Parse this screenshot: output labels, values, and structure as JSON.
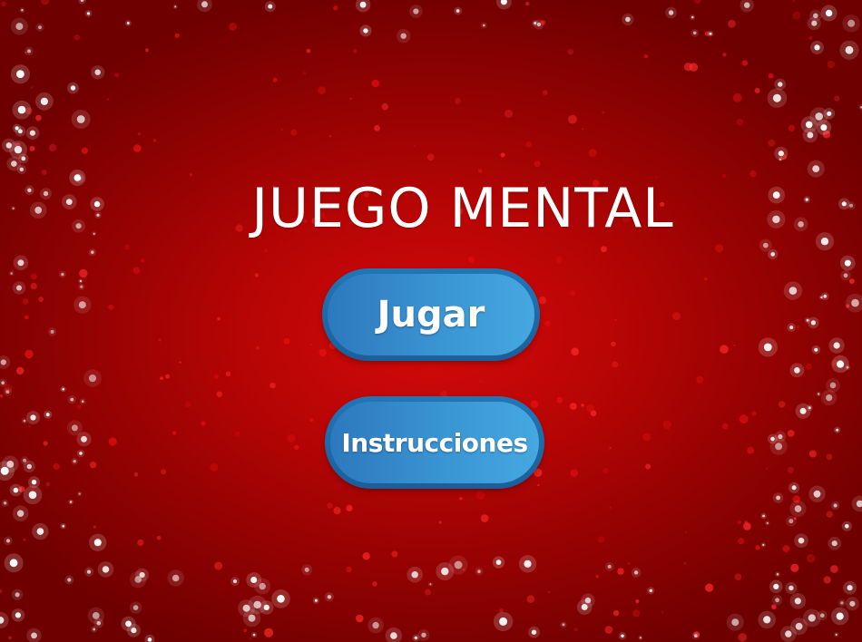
{
  "game": {
    "title": "JUEGO MENTAL",
    "buttons": {
      "play_label": "Jugar",
      "instructions_label": "Instrucciones"
    }
  },
  "colors": {
    "background": "#b80505",
    "background_edge": "#6e0000",
    "button_outer": "#1b5f99",
    "button_inner": "#3a95d3",
    "text": "#ffffff"
  },
  "icons": [
    "sparkle-dots"
  ]
}
